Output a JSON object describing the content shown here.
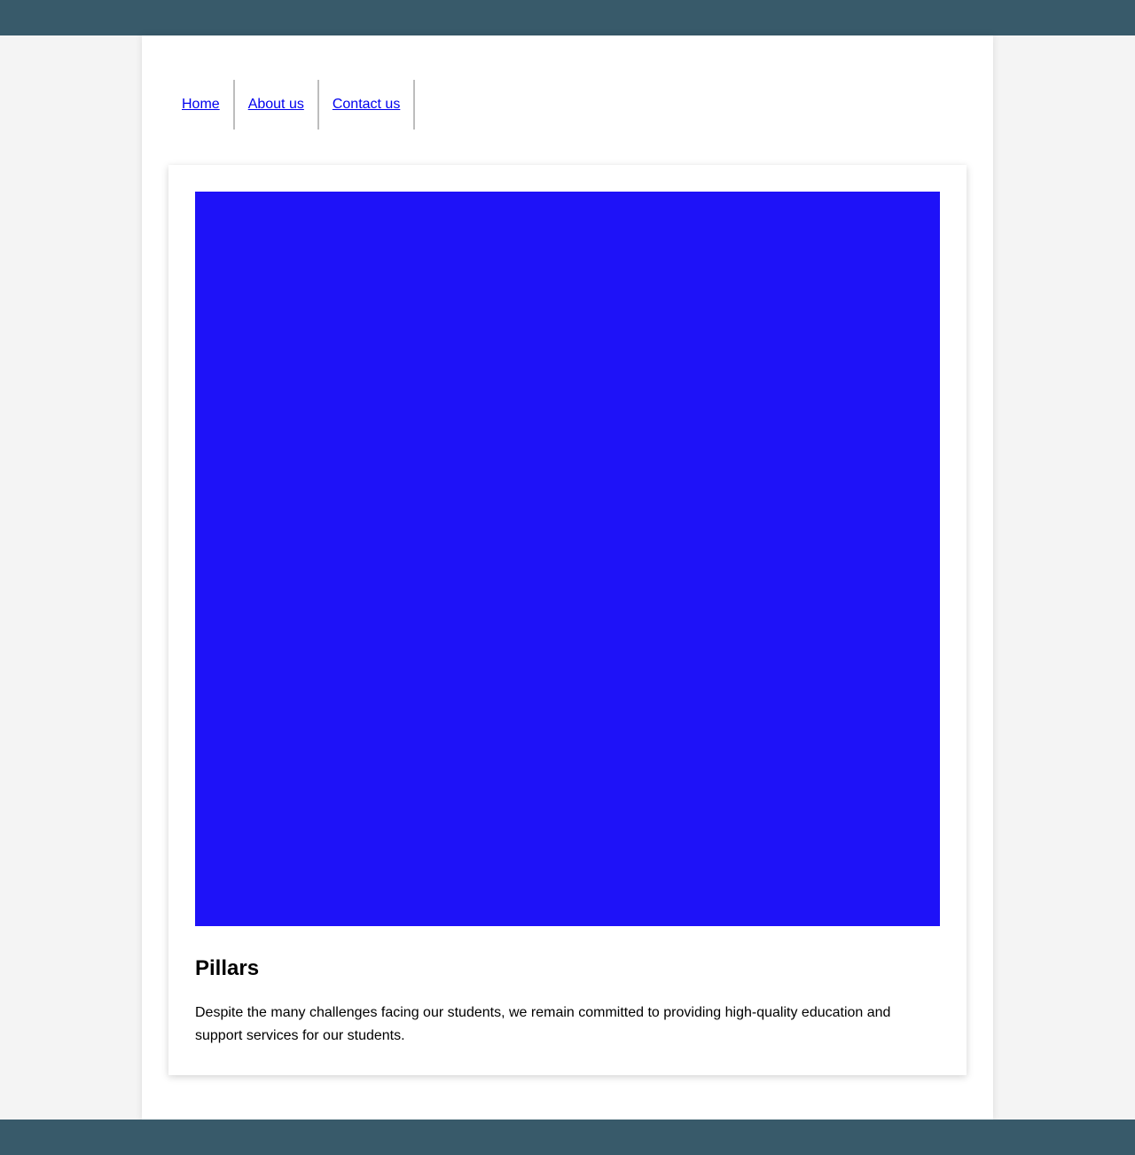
{
  "colors": {
    "header_footer": "#385a6a",
    "page_background": "#f4f4f4",
    "image_fill": "#1e12f8",
    "link": "#0000ee"
  },
  "nav": {
    "items": [
      {
        "label": "Home"
      },
      {
        "label": "About us"
      },
      {
        "label": "Contact us"
      }
    ]
  },
  "card": {
    "title": "Pillars",
    "text": "Despite the many challenges facing our students, we remain committed to providing high-quality education and support services for our students."
  }
}
